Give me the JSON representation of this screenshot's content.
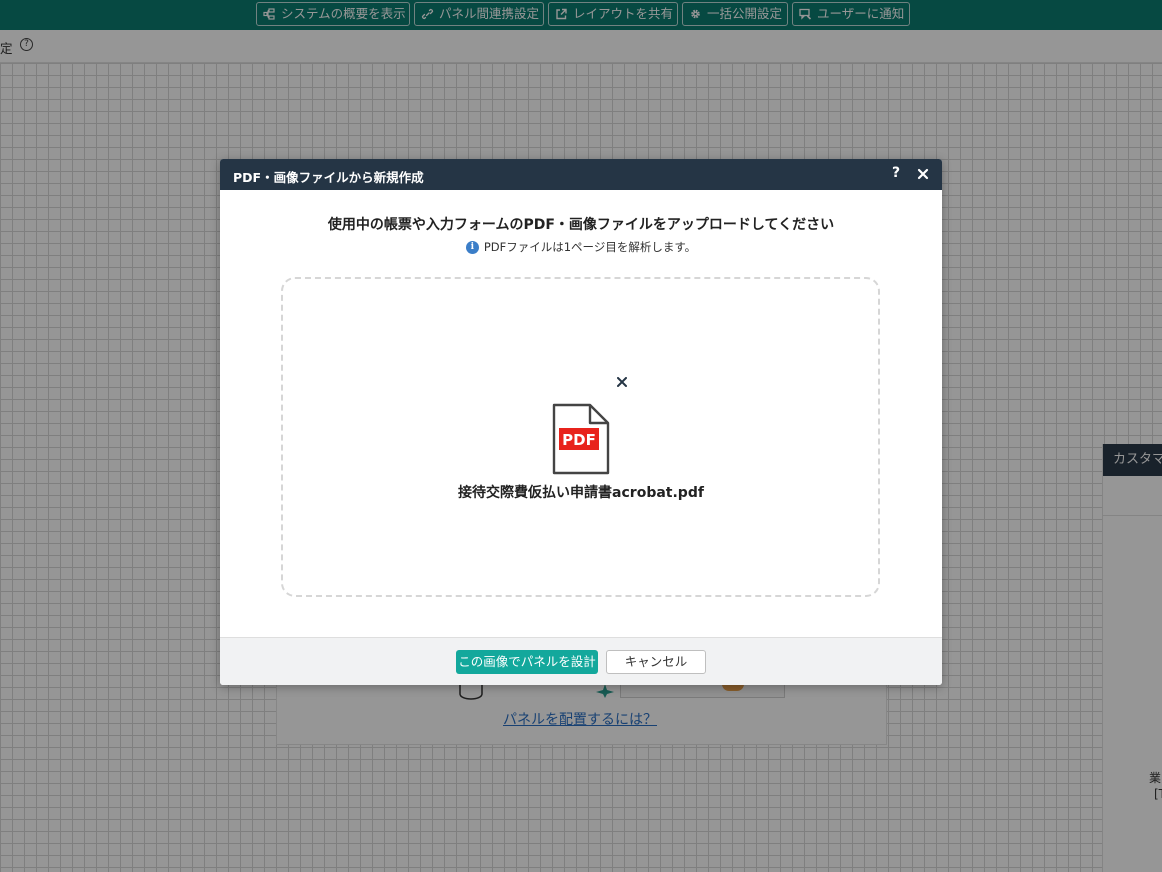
{
  "toolbar": {
    "buttons": [
      {
        "label": "システムの概要を表示",
        "icon": "sitemap-icon"
      },
      {
        "label": "パネル間連携設定",
        "icon": "link-icon"
      },
      {
        "label": "レイアウトを共有",
        "icon": "external-link-icon"
      },
      {
        "label": "一括公開設定",
        "icon": "gear-icon"
      },
      {
        "label": "ユーザーに通知",
        "icon": "notify-icon"
      }
    ]
  },
  "subbar": {
    "text": "定",
    "help": "?"
  },
  "background": {
    "link": "パネルを配置するには？",
    "side_panel_title": "カスタマ",
    "side_text_1": "業",
    "side_text_2": "[T"
  },
  "modal": {
    "title": "PDF・画像ファイルから新規作成",
    "help": "?",
    "heading": "使用中の帳票や入力フォームのPDF・画像ファイルをアップロードしてください",
    "note": "PDFファイルは1ページ目を解析します。",
    "info_icon": "i",
    "file": {
      "badge": "PDF",
      "name": "接待交際費仮払い申請書acrobat.pdf"
    },
    "primary_button": "この画像でパネルを設計",
    "cancel_button": "キャンセル"
  },
  "colors": {
    "toolbar": "#0b7c70",
    "modal_header": "#253545",
    "primary": "#13a89c",
    "pdf_red": "#e8231c"
  }
}
